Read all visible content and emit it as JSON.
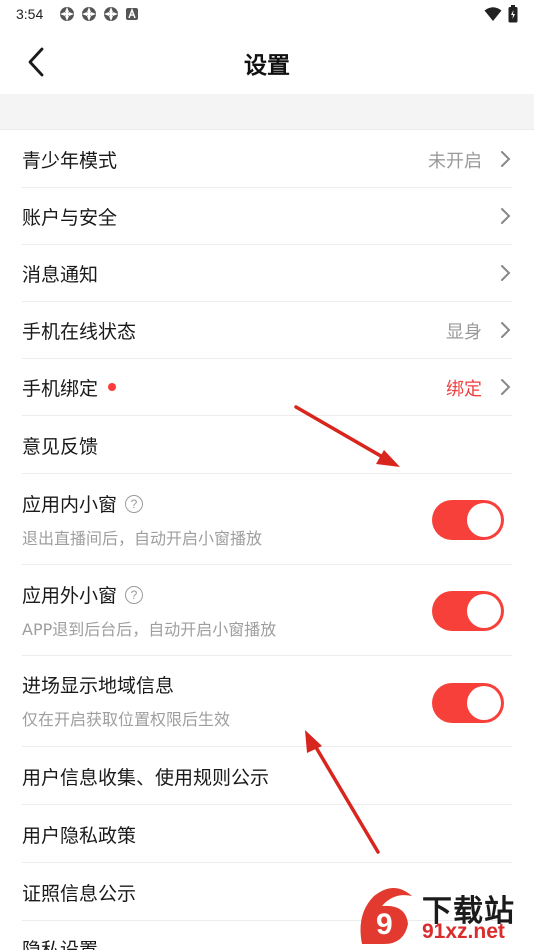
{
  "status_bar": {
    "time": "3:54",
    "icons": [
      "app-icon",
      "app-icon",
      "app-icon",
      "a-icon"
    ],
    "right_icons": [
      "wifi-icon",
      "battery-icon"
    ]
  },
  "header": {
    "title": "设置",
    "back_icon": "chevron-left-icon"
  },
  "rows": [
    {
      "id": "teen-mode",
      "label": "青少年模式",
      "value": "未开启"
    },
    {
      "id": "account-security",
      "label": "账户与安全",
      "value": ""
    },
    {
      "id": "notifications",
      "label": "消息通知",
      "value": ""
    },
    {
      "id": "online-status",
      "label": "手机在线状态",
      "value": "显身"
    },
    {
      "id": "phone-binding",
      "label": "手机绑定",
      "value": "绑定",
      "value_color": "#ee4040",
      "has_dot": true
    },
    {
      "id": "feedback",
      "label": "意见反馈",
      "value": ""
    }
  ],
  "toggles": [
    {
      "id": "in-app-window",
      "label": "应用内小窗",
      "subtitle": "退出直播间后，自动开启小窗播放",
      "has_help": true,
      "on": true
    },
    {
      "id": "out-app-window",
      "label": "应用外小窗",
      "subtitle": "APP退到后台后，自动开启小窗播放",
      "has_help": true,
      "on": true
    },
    {
      "id": "region-info",
      "label": "进场显示地域信息",
      "subtitle": "仅在开启获取位置权限后生效",
      "has_help": false,
      "on": true
    }
  ],
  "bottom_rows": [
    {
      "id": "user-info-rules",
      "label": "用户信息收集、使用规则公示"
    },
    {
      "id": "privacy-policy",
      "label": "用户隐私政策"
    },
    {
      "id": "license-info",
      "label": "证照信息公示"
    },
    {
      "id": "privacy-settings",
      "label": "隐私设置"
    }
  ],
  "colors": {
    "accent": "#f7403a",
    "secondary_text": "#9a9a9a",
    "band": "#f4f4f4"
  },
  "watermark": {
    "text": "下载站",
    "url": "91xz.net",
    "logo_text": "9"
  }
}
